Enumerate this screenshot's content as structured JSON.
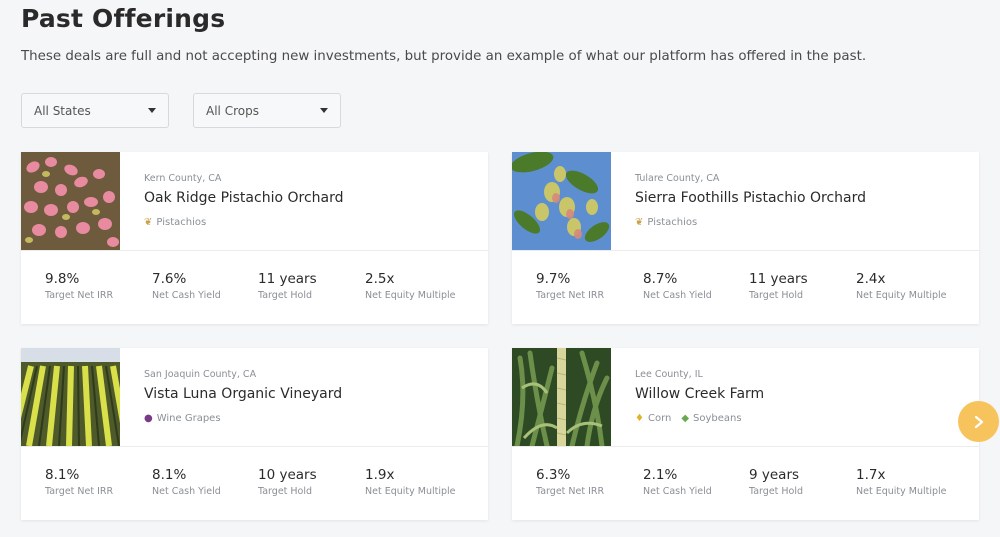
{
  "page": {
    "title": "Past Offerings",
    "subtitle": "These deals are full and not accepting new investments, but provide an example of what our platform has offered in the past."
  },
  "filters": {
    "states": "All States",
    "crops": "All Crops"
  },
  "cards": [
    {
      "county": "Kern County, CA",
      "name": "Oak Ridge Pistachio Orchard",
      "crops": [
        {
          "icon": "pistachio-icon",
          "label": "Pistachios"
        }
      ],
      "stats": [
        {
          "value": "9.8%",
          "label": "Target Net IRR"
        },
        {
          "value": "7.6%",
          "label": "Net Cash Yield"
        },
        {
          "value": "11 years",
          "label": "Target Hold"
        },
        {
          "value": "2.5x",
          "label": "Net Equity Multiple"
        }
      ]
    },
    {
      "county": "Tulare County, CA",
      "name": "Sierra Foothills Pistachio Orchard",
      "crops": [
        {
          "icon": "pistachio-icon",
          "label": "Pistachios"
        }
      ],
      "stats": [
        {
          "value": "9.7%",
          "label": "Target Net IRR"
        },
        {
          "value": "8.7%",
          "label": "Net Cash Yield"
        },
        {
          "value": "11 years",
          "label": "Target Hold"
        },
        {
          "value": "2.4x",
          "label": "Net Equity Multiple"
        }
      ]
    },
    {
      "county": "San Joaquin County, CA",
      "name": "Vista Luna Organic Vineyard",
      "crops": [
        {
          "icon": "grape-icon",
          "label": "Wine Grapes"
        }
      ],
      "stats": [
        {
          "value": "8.1%",
          "label": "Target Net IRR"
        },
        {
          "value": "8.1%",
          "label": "Net Cash Yield"
        },
        {
          "value": "10 years",
          "label": "Target Hold"
        },
        {
          "value": "1.9x",
          "label": "Net Equity Multiple"
        }
      ]
    },
    {
      "county": "Lee County, IL",
      "name": "Willow Creek Farm",
      "crops": [
        {
          "icon": "corn-icon",
          "label": "Corn"
        },
        {
          "icon": "soybean-icon",
          "label": "Soybeans"
        }
      ],
      "stats": [
        {
          "value": "6.3%",
          "label": "Target Net IRR"
        },
        {
          "value": "2.1%",
          "label": "Net Cash Yield"
        },
        {
          "value": "9 years",
          "label": "Target Hold"
        },
        {
          "value": "1.7x",
          "label": "Net Equity Multiple"
        }
      ]
    }
  ],
  "carousel": {
    "next_icon": "chevron-right-icon"
  },
  "colors": {
    "accent": "#f7c35d",
    "background": "#f5f6f8"
  }
}
